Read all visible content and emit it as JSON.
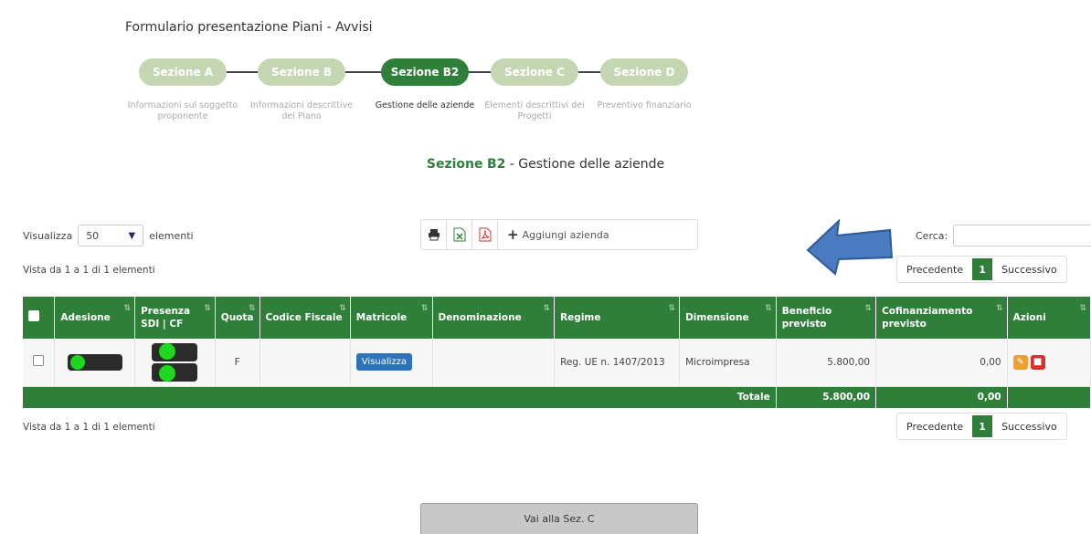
{
  "page": {
    "title": "Formulario presentazione Piani - Avvisi"
  },
  "colors": {
    "primary": "#2f7f3a",
    "step_inactive": "#c5d6b3",
    "accent_blue": "#2f72b8",
    "edit": "#f0a030",
    "delete": "#d9302c",
    "indicator_on": "#1ed61e"
  },
  "stepper": {
    "steps": [
      {
        "label": "Sezione A",
        "desc": "Informazioni sul soggetto proponente",
        "active": false
      },
      {
        "label": "Sezione B",
        "desc": "Informazioni descrittive del Piano",
        "active": false
      },
      {
        "label": "Sezione B2",
        "desc": "Gestione delle aziende",
        "active": true
      },
      {
        "label": "Sezione C",
        "desc": "Elementi descrittivi dei Progetti",
        "active": false
      },
      {
        "label": "Sezione D",
        "desc": "Preventivo finanziario",
        "active": false
      }
    ]
  },
  "section_heading": {
    "prefix": "Sezione",
    "code": "B2",
    "rest": " - Gestione delle aziende"
  },
  "controls": {
    "length_prefix": "Visualizza",
    "length_value": "50",
    "length_suffix": "elementi",
    "search_label": "Cerca:",
    "search_value": "",
    "add_company_label": "Aggiungi azienda",
    "toolbar_icons": [
      "print-icon",
      "excel-icon",
      "pdf-icon",
      "plus-icon"
    ]
  },
  "info_text": "Vista da 1 a 1 di 1 elementi",
  "pagination": {
    "prev": "Precedente",
    "current": "1",
    "next": "Successivo"
  },
  "table": {
    "columns": [
      "Adesione",
      "Presenza SDI | CF",
      "Quota",
      "Codice Fiscale",
      "Matricole",
      "Denominazione",
      "Regime",
      "Dimensione",
      "Beneficio previsto",
      "Cofinanziamento previsto",
      "Azioni"
    ],
    "rows": [
      {
        "quota": "F",
        "codice_fiscale": "",
        "matricole_button": "Visualizza",
        "denominazione": "",
        "regime": "Reg. UE n. 1407/2013",
        "dimensione": "Microimpresa",
        "beneficio": "5.800,00",
        "cofinanziamento": "0,00"
      }
    ],
    "totals": {
      "label": "Totale",
      "beneficio": "5.800,00",
      "cofinanziamento": "0,00"
    }
  },
  "footer": {
    "next_section_button": "Vai alla Sez. C"
  }
}
